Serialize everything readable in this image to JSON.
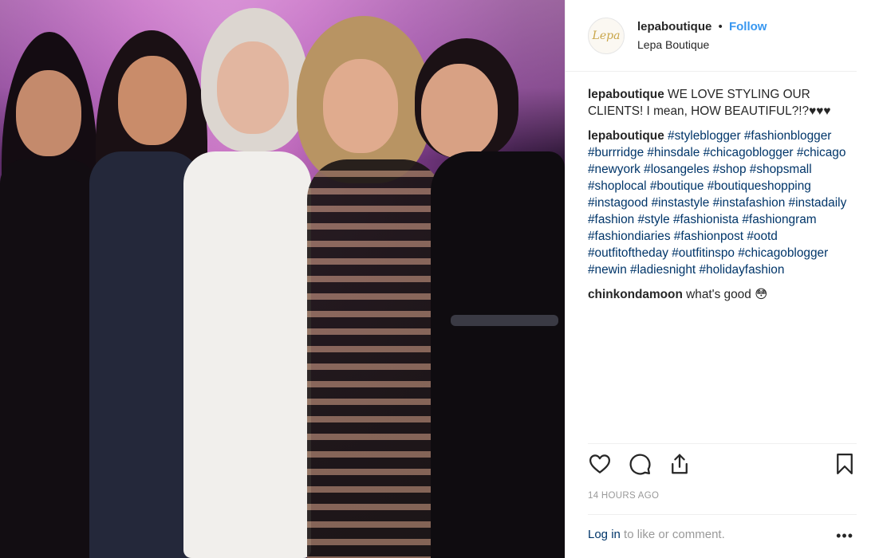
{
  "post": {
    "image_alt": "Five women posing together at an event",
    "header": {
      "avatar_text": "Lepa",
      "username": "lepaboutique",
      "separator": "•",
      "follow_label": "Follow",
      "location": "Lepa Boutique"
    },
    "comments": [
      {
        "username": "lepaboutique",
        "text": "WE LOVE STYLING OUR CLIENTS! I mean, HOW BEAUTIFUL?!?♥♥♥"
      },
      {
        "username": "lepaboutique",
        "text": "#styleblogger #fashionblogger #burrridge #hinsdale #chicagoblogger #chicago #newyork #losangeles #shop #shopsmall #shoplocal #boutique #boutiqueshopping #instagood #instastyle #instafashion #instadaily #fashion #style #fashionista #fashiongram #fashiondiaries #fashionpost #ootd #outfitoftheday #outfitinspo #chicagoblogger #newin #ladiesnight #holidayfashion"
      },
      {
        "username": "chinkondamoon",
        "text": "what's good 😳"
      }
    ],
    "actions": {
      "like_icon": "heart-icon",
      "comment_icon": "speech-bubble-icon",
      "share_icon": "share-icon",
      "save_icon": "bookmark-icon"
    },
    "timestamp": "14 HOURS AGO",
    "footer": {
      "login_label": "Log in",
      "login_suffix": " to like or comment.",
      "more_label": "•••"
    }
  },
  "colors": {
    "link_blue": "#3897f0",
    "hashtag": "#003569",
    "muted": "#999999"
  }
}
